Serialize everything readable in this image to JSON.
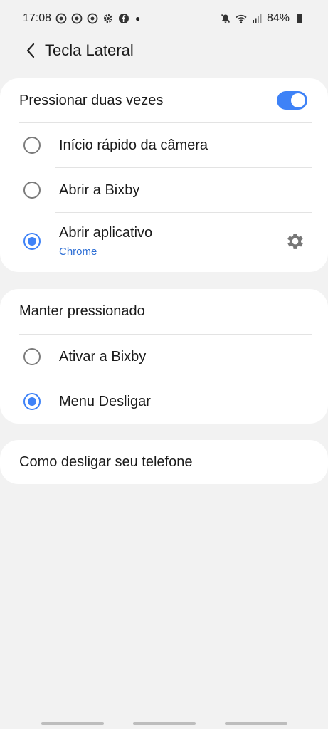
{
  "status_bar": {
    "time": "17:08",
    "battery": "84%",
    "left_icons": [
      "notification-icon",
      "notification-icon",
      "notification-icon",
      "gear-icon",
      "facebook-icon"
    ],
    "right_icons": [
      "mute-icon",
      "wifi-icon",
      "signal-icon",
      "battery-icon"
    ]
  },
  "header": {
    "title": "Tecla Lateral"
  },
  "double_press": {
    "title": "Pressionar duas vezes",
    "toggle_on": true,
    "options": [
      {
        "label": "Início rápido da câmera",
        "selected": false
      },
      {
        "label": "Abrir a Bixby",
        "selected": false
      },
      {
        "label": "Abrir aplicativo",
        "sublabel": "Chrome",
        "selected": true
      }
    ]
  },
  "long_press": {
    "title": "Manter pressionado",
    "options": [
      {
        "label": "Ativar a Bixby",
        "selected": false
      },
      {
        "label": "Menu Desligar",
        "selected": true
      }
    ]
  },
  "help": {
    "label": "Como desligar seu telefone"
  },
  "colors": {
    "accent": "#3e82f7",
    "sublabel": "#2d6ed4",
    "background": "#f2f2f2",
    "card": "#ffffff"
  }
}
